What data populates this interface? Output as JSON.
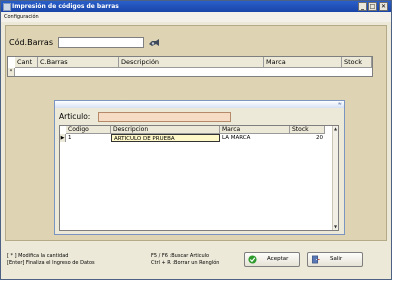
{
  "window": {
    "title": "Impresión de códigos de barras"
  },
  "window_controls": {
    "minimize": "_",
    "maximize": "□",
    "close": "✕"
  },
  "menu": {
    "items": [
      "Configuración"
    ]
  },
  "barcode": {
    "label": "Cód.Barras",
    "value": ""
  },
  "main_grid": {
    "columns": [
      "Cant",
      "C.Barras",
      "Descripción",
      "Marca",
      "Stock"
    ],
    "row_indicator": "*"
  },
  "search_panel": {
    "collapse_glyph": "≈",
    "article_label": "Articulo:",
    "article_value": "",
    "columns": [
      "Codigo",
      "Descripcion",
      "Marca",
      "Stock"
    ],
    "rows": [
      {
        "codigo": "1",
        "descripcion": "ARTICULO DE PRUEBA",
        "marca": "LA MARCA",
        "stock": "20"
      }
    ],
    "row_indicator": "▶",
    "scroll_up": "▲",
    "scroll_down": "▼"
  },
  "help": {
    "line1": "[ * ]  Modifica la cantidad",
    "line2": "[Enter]  Finaliza el Ingreso de Datos",
    "line3": "F5 / F6 :Buscar Articulo",
    "line4": "Ctrl + R :Borrar un Renglón"
  },
  "buttons": {
    "accept": "Aceptar",
    "exit": "Salir"
  }
}
